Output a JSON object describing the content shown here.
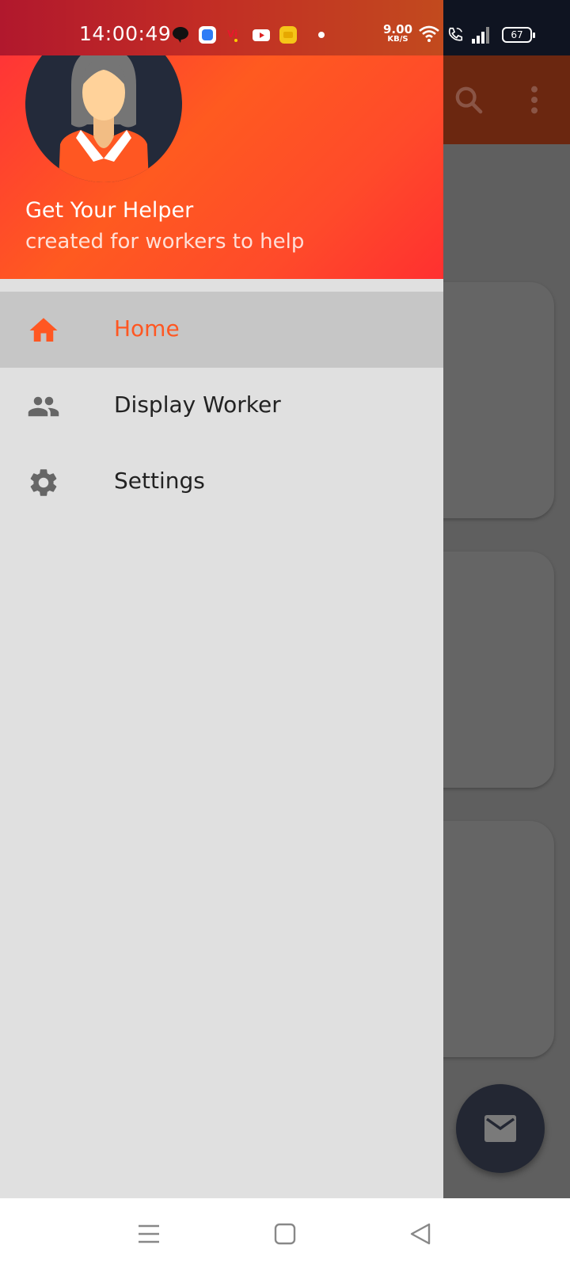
{
  "status_bar": {
    "time": "14:00:49",
    "net_speed_value": "9.00",
    "net_speed_unit": "KB/S",
    "battery": "67",
    "icons": [
      "chat-bubble-icon",
      "blue-app-icon",
      "vi-carrier-icon",
      "youtube-icon",
      "yellow-app-icon",
      "notification-dot-icon",
      "wifi-icon",
      "wifi-calling-icon",
      "signal-icon",
      "battery-icon"
    ]
  },
  "drawer": {
    "header": {
      "title": "Get Your Helper",
      "subtitle": "created for workers to help"
    },
    "items": [
      {
        "label": "Home",
        "icon": "home-icon",
        "active": true
      },
      {
        "label": "Display Worker",
        "icon": "people-icon",
        "active": false
      },
      {
        "label": "Settings",
        "icon": "gear-icon",
        "active": false
      }
    ]
  },
  "colors": {
    "accent": "#ff5722",
    "header_gradient_start": "#ff2d3b",
    "header_gradient_mid": "#ff5a20",
    "drawer_bg": "#e0e0e0",
    "active_item_bg": "#c6c6c6",
    "fab_bg": "#232733"
  },
  "toolbar_icons": [
    "search-icon",
    "more-vert-icon"
  ],
  "fab_icon": "mail-icon",
  "nav_bar_icons": [
    "recents-icon",
    "home-square-icon",
    "back-triangle-icon"
  ]
}
